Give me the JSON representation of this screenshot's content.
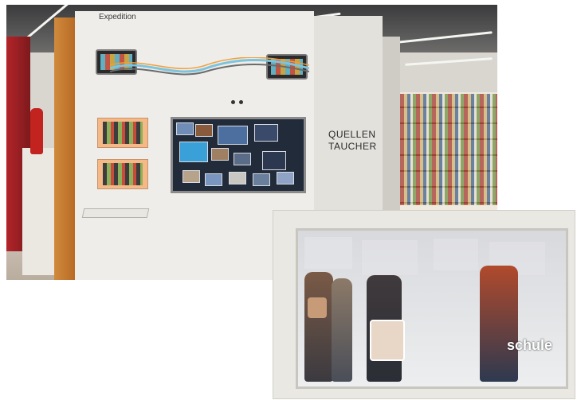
{
  "main_photo": {
    "exhibit_title": "Expedition",
    "side_panel_text": [
      "QUELLEN",
      "TAUCHER"
    ]
  },
  "inset_photo": {
    "screen_word": "schule"
  },
  "colors": {
    "kiosk_wall": "#efedea",
    "wood_trim": "#c27a2f",
    "red_wall": "#b3242a",
    "inset_background": "#e9e8e3"
  }
}
